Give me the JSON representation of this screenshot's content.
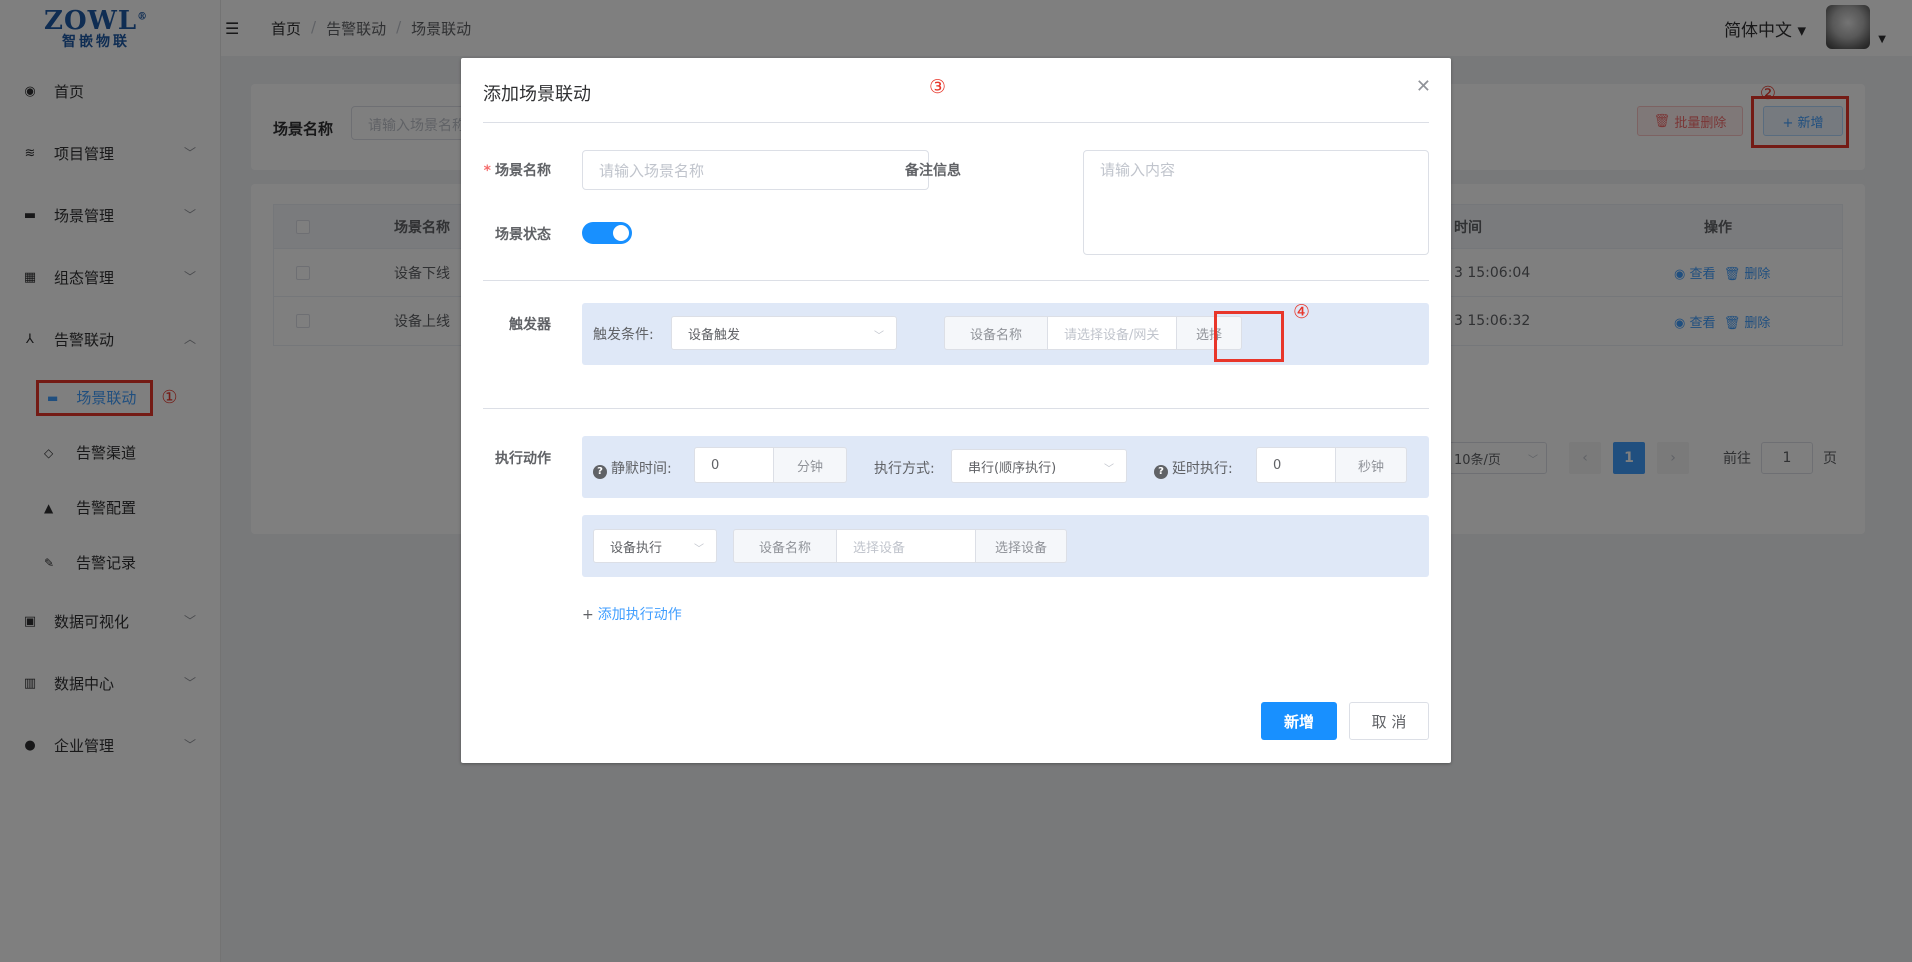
{
  "logo": {
    "main": "ZOWL",
    "reg": "®",
    "sub": "智嵌物联"
  },
  "sidebar": {
    "items": [
      {
        "label": "首页",
        "icon": "dashboard-icon"
      },
      {
        "label": "项目管理",
        "icon": "layers-icon"
      },
      {
        "label": "场景管理",
        "icon": "clapper-icon"
      },
      {
        "label": "组态管理",
        "icon": "grid-icon"
      },
      {
        "label": "告警联动",
        "icon": "alarm-link-icon"
      },
      {
        "label": "数据可视化",
        "icon": "monitor-icon"
      },
      {
        "label": "数据中心",
        "icon": "bar-chart-icon"
      },
      {
        "label": "企业管理",
        "icon": "user-org-icon"
      }
    ],
    "sub_items": [
      {
        "label": "场景联动",
        "icon": "clapper-icon"
      },
      {
        "label": "告警渠道",
        "icon": "tag-icon"
      },
      {
        "label": "告警配置",
        "icon": "alarm-icon"
      },
      {
        "label": "告警记录",
        "icon": "edit-doc-icon"
      }
    ],
    "annotation_1": "①"
  },
  "header": {
    "breadcrumb": [
      "首页",
      "告警联动",
      "场景联动"
    ],
    "language": "简体中文 ▾"
  },
  "search": {
    "label": "场景名称",
    "placeholder": "请输入场景名称",
    "batch_delete": "批量删除",
    "add": "+ 新增",
    "annotation_2": "②"
  },
  "table": {
    "headers": {
      "name": "场景名称",
      "time": "时间",
      "ops": "操作"
    },
    "rows": [
      {
        "name": "设备下线",
        "time": "3 15:06:04",
        "view": "查看",
        "del": "删除"
      },
      {
        "name": "设备上线",
        "time": "3 15:06:32",
        "view": "查看",
        "del": "删除"
      }
    ]
  },
  "pagination": {
    "size": "10条/页",
    "current": "1",
    "goto_prefix": "前往",
    "goto_value": "1",
    "goto_suffix": "页"
  },
  "dialog": {
    "title": "添加场景联动",
    "annotation_3": "③",
    "name_label": "场景名称",
    "name_placeholder": "请输入场景名称",
    "remark_label": "备注信息",
    "remark_placeholder": "请输入内容",
    "status_label": "场景状态",
    "trigger_label": "触发器",
    "trigger_condition_label": "触发条件:",
    "trigger_condition_value": "设备触发",
    "device_name_label": "设备名称",
    "device_placeholder": "请选择设备/网关",
    "choose_btn": "选择",
    "annotation_4": "④",
    "action_label": "执行动作",
    "silence_label": "静默时间:",
    "silence_value": "0",
    "silence_unit": "分钟",
    "mode_label": "执行方式:",
    "mode_value": "串行(顺序执行)",
    "delay_label": "延时执行:",
    "delay_value": "0",
    "delay_unit": "秒钟",
    "exec_type": "设备执行",
    "exec_device_label": "设备名称",
    "exec_device_placeholder": "选择设备",
    "exec_choose_btn": "选择设备",
    "add_action": "添加执行动作",
    "add_action_plus": "+",
    "confirm": "新增",
    "cancel": "取 消"
  },
  "colors": {
    "primary": "#1890ff",
    "annotation": "#e8362a",
    "panel": "#dfe8f7"
  }
}
